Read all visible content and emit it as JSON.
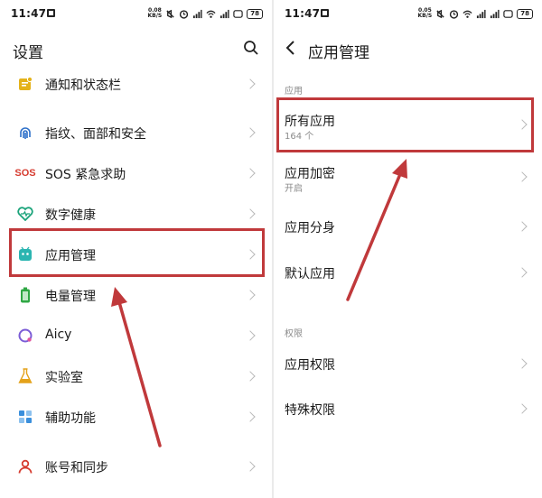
{
  "left_screen": {
    "status": {
      "time": "11:47",
      "net_speed_top": "0.08",
      "net_speed_bottom": "KB/S",
      "battery": "78"
    },
    "title": "设置",
    "items": [
      {
        "label": "通知和状态栏",
        "icon": "notification-icon"
      },
      {
        "label": "指纹、面部和安全",
        "icon": "fingerprint-icon"
      },
      {
        "label": "SOS 紧急求助",
        "icon_text": "SOS",
        "icon": "sos-icon"
      },
      {
        "label": "数字健康",
        "icon": "digital-health-icon"
      },
      {
        "label": "应用管理",
        "icon": "app-management-icon"
      },
      {
        "label": "电量管理",
        "icon": "battery-icon"
      },
      {
        "label": "Aicy",
        "icon": "aicy-icon"
      },
      {
        "label": "实验室",
        "icon": "lab-flask-icon"
      },
      {
        "label": "辅助功能",
        "icon": "accessibility-icon"
      },
      {
        "label": "账号和同步",
        "icon": "account-icon"
      }
    ]
  },
  "right_screen": {
    "status": {
      "time": "11:47",
      "net_speed_top": "0.05",
      "net_speed_bottom": "KB/S",
      "battery": "78"
    },
    "title": "应用管理",
    "section_apps": "应用",
    "all_apps": {
      "label": "所有应用",
      "sub": "164 个"
    },
    "app_lock": {
      "label": "应用加密",
      "sub": "开启"
    },
    "app_clone": {
      "label": "应用分身"
    },
    "default_apps": {
      "label": "默认应用"
    },
    "section_permissions": "权限",
    "app_permissions": {
      "label": "应用权限"
    },
    "special_permissions": {
      "label": "特殊权限"
    }
  },
  "annotation_color": "#c0393b"
}
